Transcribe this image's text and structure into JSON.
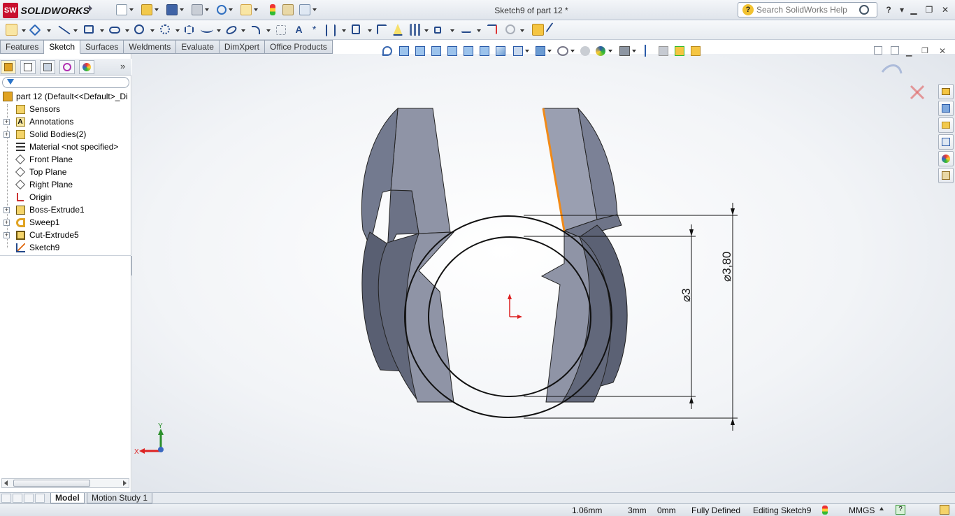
{
  "app": {
    "name": "SOLIDWORKS",
    "document_title": "Sketch9 of part 12 *"
  },
  "help": {
    "search_placeholder": "Search SolidWorks Help"
  },
  "command_tabs": [
    "Features",
    "Sketch",
    "Surfaces",
    "Weldments",
    "Evaluate",
    "DimXpert",
    "Office Products"
  ],
  "active_tab": "Sketch",
  "feature_tree": {
    "root": "part 12  (Default<<Default>_Di",
    "items": [
      {
        "label": "Sensors",
        "icon": "sensor-icon",
        "expandable": false
      },
      {
        "label": "Annotations",
        "icon": "annotation-icon",
        "expandable": true
      },
      {
        "label": "Solid Bodies(2)",
        "icon": "solid-bodies-icon",
        "expandable": true
      },
      {
        "label": "Material <not specified>",
        "icon": "material-icon",
        "expandable": false
      },
      {
        "label": "Front Plane",
        "icon": "plane-icon",
        "expandable": false
      },
      {
        "label": "Top Plane",
        "icon": "plane-icon",
        "expandable": false
      },
      {
        "label": "Right Plane",
        "icon": "plane-icon",
        "expandable": false
      },
      {
        "label": "Origin",
        "icon": "origin-icon",
        "expandable": false
      },
      {
        "label": "Boss-Extrude1",
        "icon": "boss-extrude-icon",
        "expandable": true
      },
      {
        "label": "Sweep1",
        "icon": "sweep-icon",
        "expandable": true
      },
      {
        "label": "Cut-Extrude5",
        "icon": "cut-extrude-icon",
        "expandable": true
      },
      {
        "label": "Sketch9",
        "icon": "sketch-icon",
        "expandable": false
      }
    ]
  },
  "dimensions": {
    "outer": "⌀3,80",
    "inner": "⌀3"
  },
  "triad": {
    "y": "Y",
    "x": "X"
  },
  "bottom_tabs": [
    "Model",
    "Motion Study 1"
  ],
  "status": {
    "x_coord": "1.06mm",
    "y_coord": "3mm",
    "z_coord": "0mm",
    "state": "Fully Defined",
    "mode": "Editing Sketch9",
    "units": "MMGS"
  },
  "colors": {
    "model_face": "#8f94a6",
    "model_face_dark": "#61677a",
    "highlight_edge": "#f28a17",
    "accent": "#c8102e"
  }
}
